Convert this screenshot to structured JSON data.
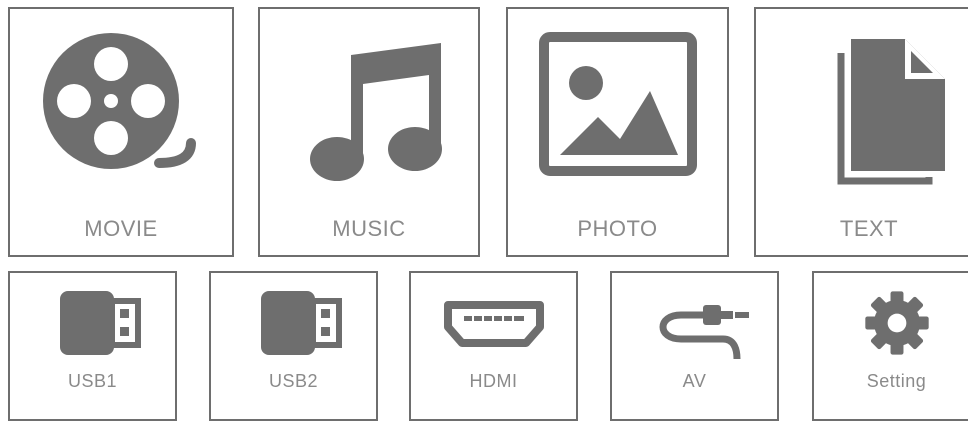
{
  "theme": {
    "icon_color": "#6e6e6e",
    "label_color": "#8a8a8a",
    "border_color": "#6e6e6e"
  },
  "tiles_main": [
    {
      "label": "MOVIE",
      "icon": "film-reel-icon"
    },
    {
      "label": "MUSIC",
      "icon": "music-note-icon"
    },
    {
      "label": "PHOTO",
      "icon": "image-icon"
    },
    {
      "label": "TEXT",
      "icon": "document-icon"
    }
  ],
  "tiles_source": [
    {
      "label": "USB1",
      "icon": "usb-icon"
    },
    {
      "label": "USB2",
      "icon": "usb-icon"
    },
    {
      "label": "HDMI",
      "icon": "hdmi-icon"
    },
    {
      "label": "AV",
      "icon": "av-cable-icon"
    },
    {
      "label": "Setting",
      "icon": "gear-icon"
    }
  ]
}
